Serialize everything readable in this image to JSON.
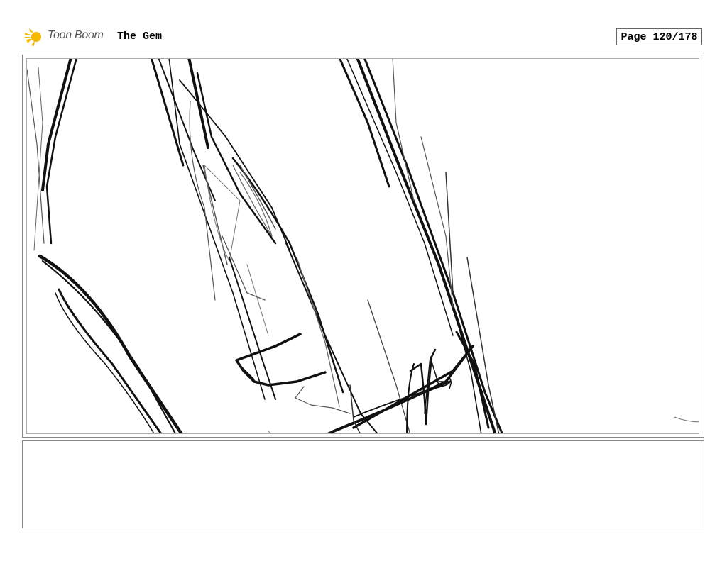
{
  "header": {
    "logo": {
      "text": "Toon Boom",
      "icon": "toon-boom-sun-icon",
      "accent_color": "#F5B800"
    },
    "project_title": "The Gem",
    "page_label": "Page 120/178"
  },
  "panel": {
    "drawing": "rough-pencil-sketch",
    "stroke_color": "#111111"
  },
  "notes": {
    "text": ""
  }
}
